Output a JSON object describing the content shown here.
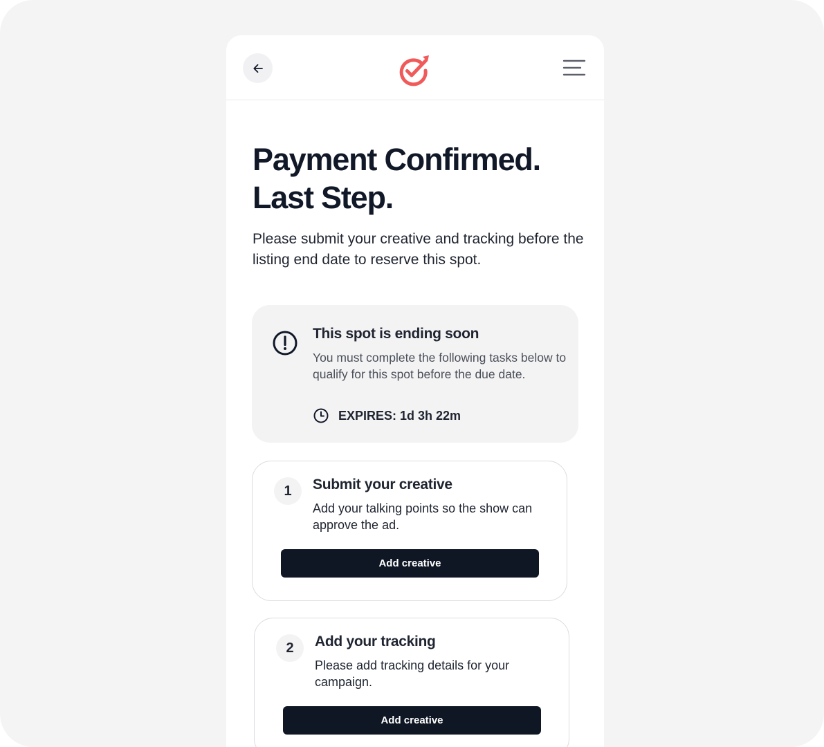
{
  "header": {
    "back_icon": "arrow-left-icon",
    "logo_icon": "target-check-arrow-logo",
    "menu_icon": "hamburger-menu-icon",
    "brand_color": "#f05a5a"
  },
  "page": {
    "title_line1": "Payment Confirmed.",
    "title_line2": "Last Step.",
    "subtitle": "Please submit your creative and tracking before the listing end date to reserve this spot."
  },
  "alert": {
    "icon": "exclamation-circle-icon",
    "title": "This spot is ending soon",
    "body": "You must complete the following tasks below to qualify for this spot before the due date.",
    "clock_icon": "clock-icon",
    "expires": "EXPIRES: 1d 3h 22m"
  },
  "tasks": [
    {
      "number": "1",
      "title": "Submit your creative",
      "description": "Add your talking points so the show can approve the ad.",
      "button_label": "Add creative"
    },
    {
      "number": "2",
      "title": "Add your tracking",
      "description": "Please add tracking details for your campaign.",
      "button_label": "Add creative"
    }
  ]
}
